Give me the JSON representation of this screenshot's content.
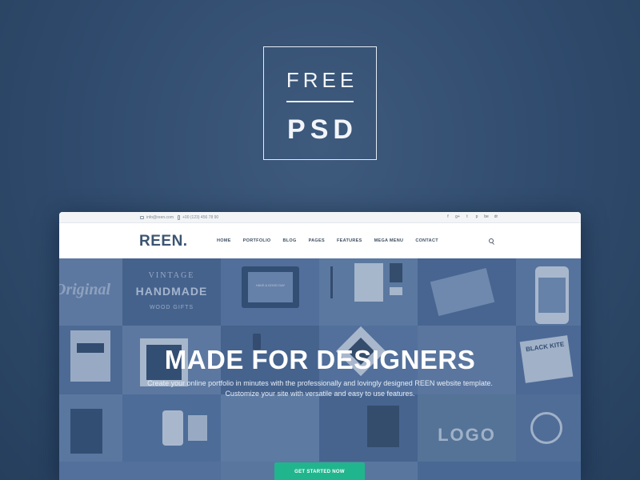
{
  "badge": {
    "top": "FREE",
    "bottom": "PSD"
  },
  "site": {
    "topbar": {
      "email": "info@reen.com",
      "phone": "+00 (123) 456 78 90",
      "socials": [
        "f",
        "g+",
        "t",
        "p",
        "be",
        "dr"
      ]
    },
    "logo": "REEN.",
    "nav": [
      "HOME",
      "PORTFOLIO",
      "BLOG",
      "PAGES",
      "FEATURES",
      "MEGA MENU",
      "CONTACT"
    ],
    "hero": {
      "title": "MADE FOR DESIGNERS",
      "subtitle": "Create your online portfolio in minutes with the professionally and lovingly designed REEN website template. Customize your site with versatile and easy to use features.",
      "cta": "GET STARTED NOW"
    },
    "tile_text": {
      "vintage": "VINTAGE",
      "handmade": "HANDMADE",
      "wood_gifts": "WOOD GIFTS",
      "good_day": "HAVE A GOOD DAY",
      "logo": "LOGO",
      "black_kite": "BLACK KITE",
      "original": "Original"
    }
  },
  "colors": {
    "background": "#2f4a6c",
    "hero_tint": "#4f6e98",
    "accent": "#21b58e",
    "logo": "#3b5472"
  }
}
